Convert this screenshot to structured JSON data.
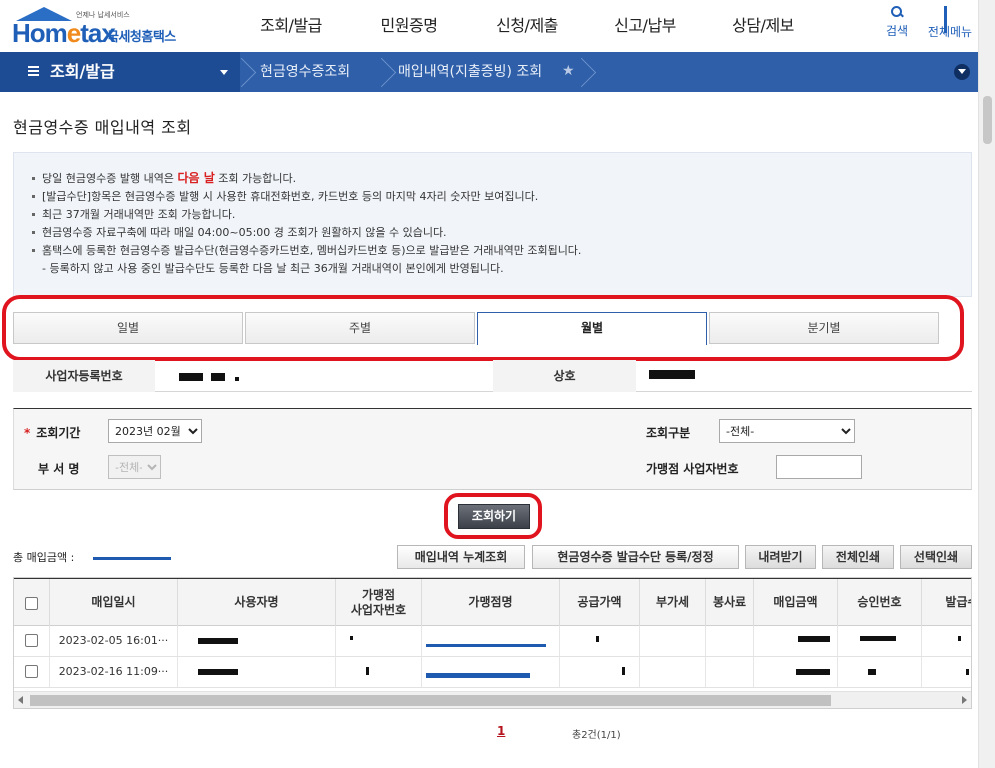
{
  "header": {
    "logo": {
      "brand": "Hometax",
      "brand_home": "Hom",
      "brand_e": "e",
      "brand_tax": "tax",
      "tagline": "언제나 납세서비스",
      "name_kr": "국세청홈택스"
    },
    "gnb": [
      "조회/발급",
      "민원증명",
      "신청/제출",
      "신고/납부",
      "상담/제보"
    ],
    "search_label": "검색",
    "all_menu_label": "전체메뉴"
  },
  "location": {
    "current": "조회/발급",
    "crumbs": [
      "현금영수증조회",
      "매입내역(지출증빙) 조회"
    ]
  },
  "page_title": "현금영수증 매입내역 조회",
  "info": {
    "line1_pre": "당일 현금영수증 발행 내역은 ",
    "line1_hl": "다음 날",
    "line1_post": " 조회 가능합니다.",
    "line2": "[발급수단]항목은 현금영수증 발행 시 사용한 휴대전화번호, 카드번호 등의 마지막 4자리 숫자만 보여집니다.",
    "line3": "최근 37개월 거래내역만 조회 가능합니다.",
    "line4": "현금영수증 자료구축에 따라 매일 04:00~05:00 경 조회가 원활하지 않을 수 있습니다.",
    "line5": "홈택스에 등록한 현금영수증 발급수단(현금영수증카드번호, 멤버십카드번호 등)으로 발급받은 거래내역만 조회됩니다.",
    "line6": "- 등록하지 않고 사용 중인 발급수단도 등록한 다음 날 최근 36개월 거래내역이 본인에게 반영됩니다."
  },
  "tabs": [
    {
      "label": "일별",
      "active": false
    },
    {
      "label": "주별",
      "active": false
    },
    {
      "label": "월별",
      "active": true
    },
    {
      "label": "분기별",
      "active": false
    }
  ],
  "business": {
    "reg_no_label": "사업자등록번호",
    "name_label": "상호"
  },
  "form": {
    "period_label": "조회기간",
    "period_value": "2023년 02월",
    "category_label": "조회구분",
    "category_value": "-전체-",
    "dept_label": "부 서 명",
    "dept_value": "-전체-",
    "merchant_reg_label": "가맹점 사업자번호",
    "merchant_reg_value": ""
  },
  "query_button": "조회하기",
  "total_label": "총 매입금액 :",
  "actions": {
    "cumulative": "매입내역 누계조회",
    "register": "현금영수증 발급수단 등록/정정",
    "download": "내려받기",
    "print_all": "전체인쇄",
    "print_selected": "선택인쇄"
  },
  "table": {
    "headers": {
      "date": "매입일시",
      "user": "사용자명",
      "merchant_reg_1": "가맹점",
      "merchant_reg_2": "사업자번호",
      "merchant_name": "가맹점명",
      "supply": "공급가액",
      "vat": "부가세",
      "tip": "봉사료",
      "amount": "매입금액",
      "approval": "승인번호",
      "issue_method": "발급수단"
    },
    "rows": [
      {
        "date": "2023-02-05 16:01···"
      },
      {
        "date": "2023-02-16 11:09···"
      }
    ]
  },
  "paging": {
    "current": "1",
    "summary": "총2건(1/1)"
  },
  "colors": {
    "accent": "#2e5fa8",
    "highlight": "#e0141e",
    "emphasis": "#d92020"
  }
}
